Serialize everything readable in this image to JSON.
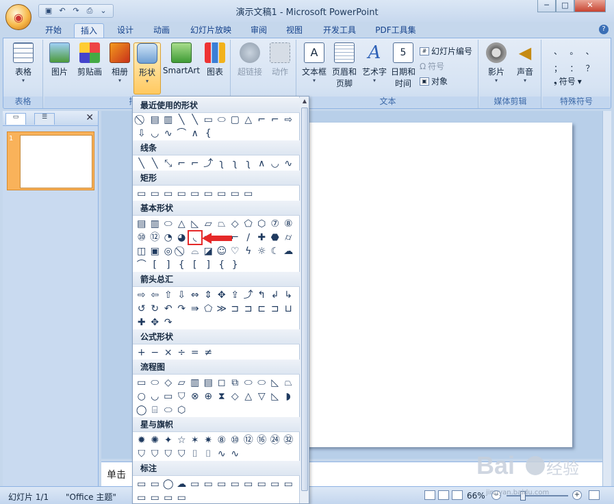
{
  "window": {
    "title": "演示文稿1 - Microsoft PowerPoint",
    "qat_icons": [
      "save-icon",
      "undo-icon",
      "redo-icon",
      "print-preview-icon",
      "customize-icon"
    ],
    "min": "─",
    "max": "□",
    "close": "✕"
  },
  "tabs": [
    {
      "label": "开始"
    },
    {
      "label": "插入"
    },
    {
      "label": "设计"
    },
    {
      "label": "动画"
    },
    {
      "label": "幻灯片放映"
    },
    {
      "label": "审阅"
    },
    {
      "label": "视图"
    },
    {
      "label": "开发工具"
    },
    {
      "label": "PDF工具集"
    }
  ],
  "active_tab": "插入",
  "ribbon": {
    "groups": {
      "table": {
        "label": "表格",
        "button": "表格"
      },
      "illustrations": {
        "label": "插图",
        "picture": "图片",
        "clipart": "剪贴画",
        "album": "相册",
        "shapes": "形状",
        "smartart": "SmartArt",
        "chart": "图表"
      },
      "links": {
        "label": "链接",
        "hyperlink": "超链接",
        "action": "动作"
      },
      "text": {
        "label": "文本",
        "textbox": "文本框",
        "header1": "页眉和",
        "header2": "页脚",
        "wordart": "艺术字",
        "date1": "日期和",
        "date2": "时间",
        "slide_number": "幻灯片编号",
        "symbol": "符号",
        "object": "对象"
      },
      "media": {
        "label": "媒体剪辑",
        "movie": "影片",
        "sound": "声音"
      },
      "special": {
        "label": "特殊符号",
        "symbol": "符号",
        "chars": [
          "、",
          "。",
          "、",
          "；",
          "：",
          "？"
        ]
      }
    }
  },
  "left_pane": {
    "slide_number": "1"
  },
  "notes": {
    "placeholder": "单击"
  },
  "status": {
    "slide": "幻灯片 1/1",
    "theme": "\"Office 主题\"",
    "zoom": "66%"
  },
  "gallery": {
    "sections": [
      {
        "title": "最近使用的形状",
        "rows": [
          [
            "⃠",
            "▤",
            "▥",
            "╲",
            "╲",
            "▭",
            "⬭",
            "▢",
            "△",
            "⌐",
            "⌐",
            "⇨"
          ],
          [
            "⇩",
            "◡",
            "∿",
            "⌒",
            "∧",
            "{"
          ]
        ]
      },
      {
        "title": "线条",
        "rows": [
          [
            "╲",
            "╲",
            "⤡",
            "⌐",
            "⌐",
            "⤴",
            "ʅ",
            "ʅ",
            "ʅ",
            "∧",
            "◡",
            "∿"
          ]
        ]
      },
      {
        "title": "矩形",
        "rows": [
          [
            "▭",
            "▭",
            "▭",
            "▭",
            "▭",
            "▭",
            "▭",
            "▭",
            "▭"
          ]
        ]
      },
      {
        "title": "基本形状",
        "rows": [
          [
            "▤",
            "▥",
            "⬭",
            "△",
            "◺",
            "▱",
            "⏢",
            "◇",
            "⬠",
            "⬡",
            "⑦",
            "⑧"
          ],
          [
            "⑩",
            "⑫",
            "◔",
            "◕",
            "◟",
            "▭",
            "▬",
            "⌐",
            "∕",
            "✚",
            "⬣",
            "⌭"
          ],
          [
            "◫",
            "▣",
            "◎",
            "⃠",
            "⌓",
            "◪",
            "☺",
            "♡",
            "ϟ",
            "☼",
            "☾",
            "☁"
          ],
          [
            "⌒",
            "[",
            "]",
            "{",
            "[",
            "]",
            "{",
            "}"
          ]
        ]
      },
      {
        "title": "箭头总汇",
        "rows": [
          [
            "⇨",
            "⇦",
            "⇧",
            "⇩",
            "⇔",
            "⇕",
            "✥",
            "⇪",
            "⤴",
            "↰",
            "↲",
            "↳"
          ],
          [
            "↺",
            "↻",
            "↶",
            "↷",
            "⇛",
            "⬠",
            "≫",
            "⊐",
            "⊐",
            "⊏",
            "⊐",
            "⊔"
          ],
          [
            "✚",
            "✥",
            "↷"
          ]
        ]
      },
      {
        "title": "公式形状",
        "rows": [
          [
            "+",
            "−",
            "×",
            "÷",
            "=",
            "≠"
          ]
        ]
      },
      {
        "title": "流程图",
        "rows": [
          [
            "▭",
            "⬭",
            "◇",
            "▱",
            "▥",
            "▤",
            "◻",
            "⧉",
            "⬭",
            "⬭",
            "◺",
            "⏢"
          ],
          [
            "○",
            "◡",
            "▭",
            "⛉",
            "⊗",
            "⊕",
            "⧗",
            "◇",
            "△",
            "▽",
            "◺",
            "◗"
          ],
          [
            "◯",
            "⌸",
            "⬭",
            "⬡"
          ]
        ]
      },
      {
        "title": "星与旗帜",
        "rows": [
          [
            "✹",
            "✺",
            "✦",
            "☆",
            "✶",
            "✷",
            "⑧",
            "⑩",
            "⑫",
            "⑯",
            "㉔",
            "㉜"
          ],
          [
            "⛉",
            "⛉",
            "⛉",
            "⛉",
            "⌷",
            "⌷",
            "∿",
            "∿"
          ]
        ]
      },
      {
        "title": "标注",
        "rows": [
          [
            "▭",
            "▭",
            "◯",
            "☁",
            "▭",
            "▭",
            "▭",
            "▭",
            "▭",
            "▭",
            "▭",
            "▭"
          ],
          [
            "▭",
            "▭",
            "▭",
            "▭"
          ]
        ]
      }
    ]
  },
  "watermark": {
    "text": "Baidu经验",
    "url": "jingyan.baidu.com"
  }
}
